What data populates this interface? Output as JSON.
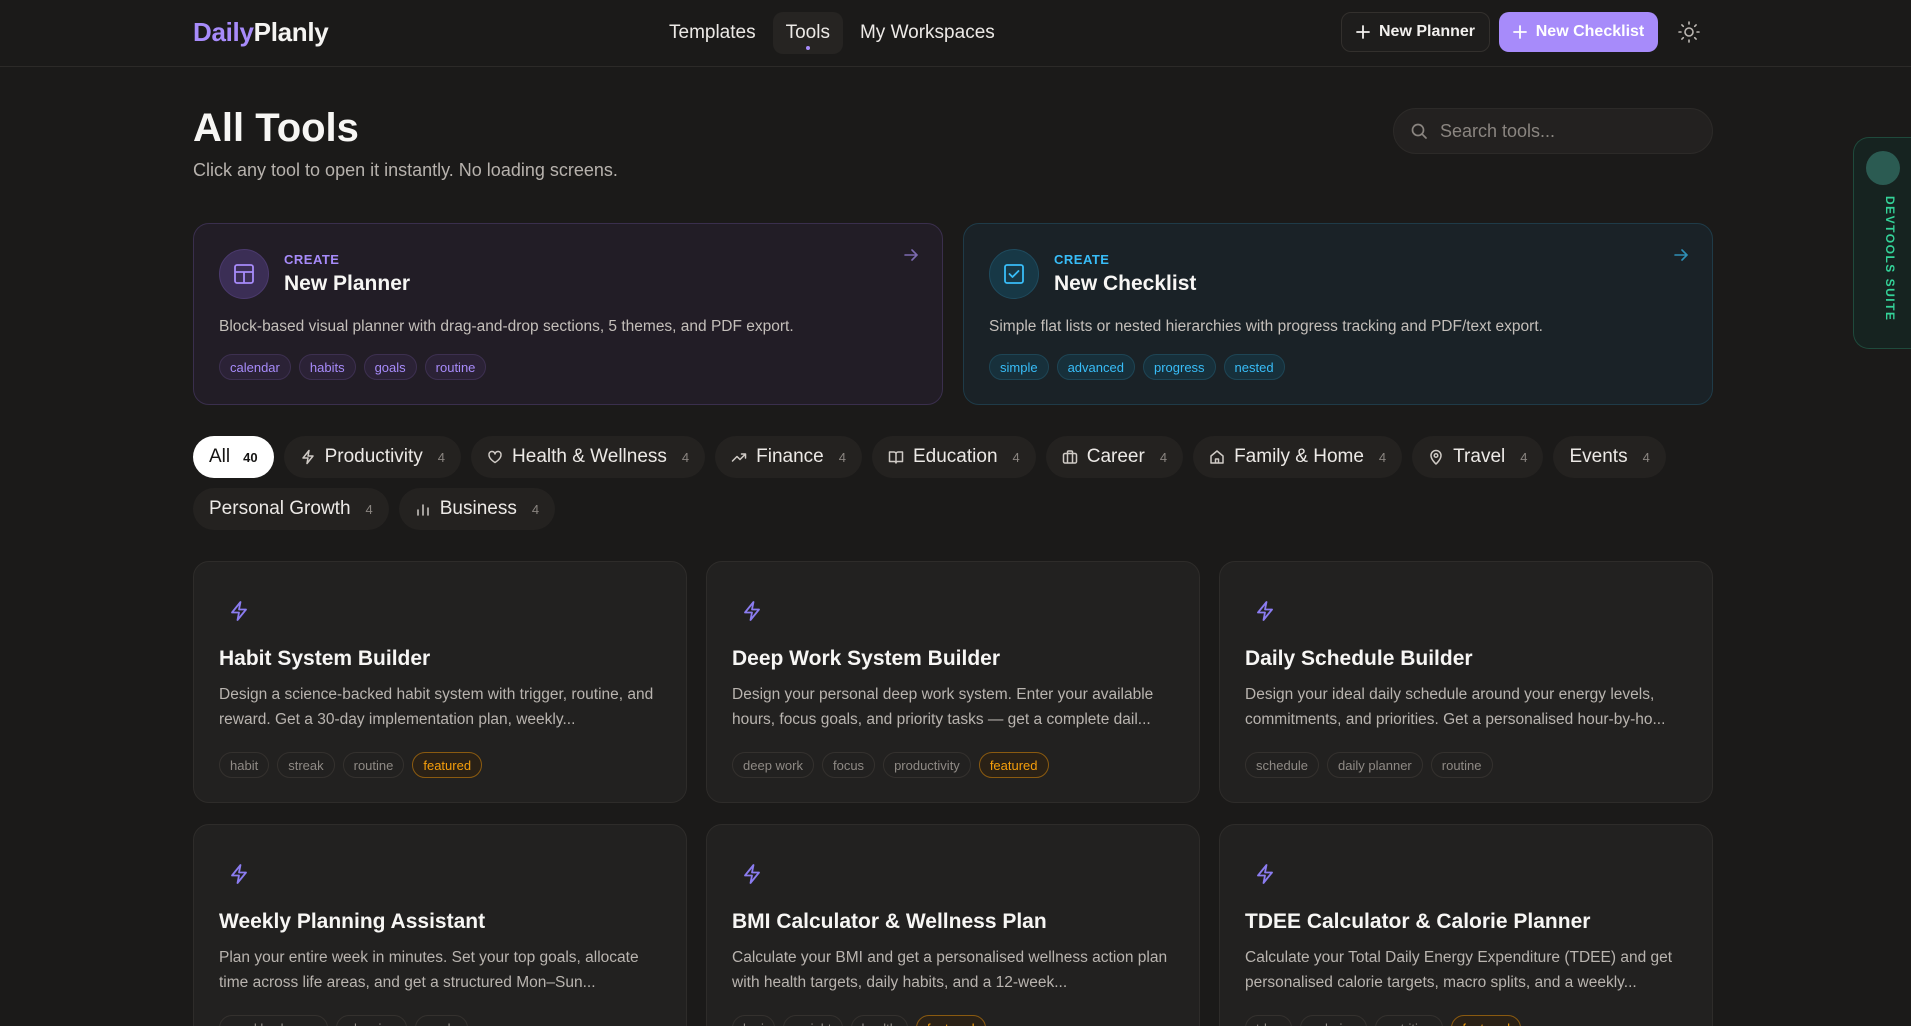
{
  "brand": {
    "part1": "Daily",
    "part2": "Planly"
  },
  "nav": {
    "items": [
      "Templates",
      "Tools",
      "My Workspaces"
    ],
    "active": "Tools"
  },
  "header": {
    "new_planner": "New Planner",
    "new_checklist": "New Checklist"
  },
  "page": {
    "title": "All Tools",
    "subtitle": "Click any tool to open it instantly. No loading screens.",
    "search_placeholder": "Search tools..."
  },
  "create_cards": [
    {
      "kicker": "CREATE",
      "title": "New Planner",
      "desc": "Block-based visual planner with drag-and-drop sections, 5 themes, and PDF export.",
      "tags": [
        "calendar",
        "habits",
        "goals",
        "routine"
      ]
    },
    {
      "kicker": "CREATE",
      "title": "New Checklist",
      "desc": "Simple flat lists or nested hierarchies with progress tracking and PDF/text export.",
      "tags": [
        "simple",
        "advanced",
        "progress",
        "nested"
      ]
    }
  ],
  "filters": [
    {
      "label": "All",
      "count": "40",
      "icon": ""
    },
    {
      "label": "Productivity",
      "count": "4",
      "icon": "bolt-icon"
    },
    {
      "label": "Health & Wellness",
      "count": "4",
      "icon": "heart-icon"
    },
    {
      "label": "Finance",
      "count": "4",
      "icon": "trending-up-icon"
    },
    {
      "label": "Education",
      "count": "4",
      "icon": "book-icon"
    },
    {
      "label": "Career",
      "count": "4",
      "icon": "briefcase-icon"
    },
    {
      "label": "Family & Home",
      "count": "4",
      "icon": "home-icon"
    },
    {
      "label": "Travel",
      "count": "4",
      "icon": "map-pin-icon"
    },
    {
      "label": "Events",
      "count": "4",
      "icon": ""
    },
    {
      "label": "Personal Growth",
      "count": "4",
      "icon": ""
    },
    {
      "label": "Business",
      "count": "4",
      "icon": "bar-chart-icon"
    }
  ],
  "tools": [
    {
      "title": "Habit System Builder",
      "desc": "Design a science-backed habit system with trigger, routine, and reward. Get a 30-day implementation plan, weekly...",
      "tags": [
        "habit",
        "streak",
        "routine",
        "featured"
      ]
    },
    {
      "title": "Deep Work System Builder",
      "desc": "Design your personal deep work system. Enter your available hours, focus goals, and priority tasks — get a complete dail...",
      "tags": [
        "deep work",
        "focus",
        "productivity",
        "featured"
      ]
    },
    {
      "title": "Daily Schedule Builder",
      "desc": "Design your ideal daily schedule around your energy levels, commitments, and priorities. Get a personalised hour-by-ho...",
      "tags": [
        "schedule",
        "daily planner",
        "routine"
      ]
    },
    {
      "title": "Weekly Planning Assistant",
      "desc": "Plan your entire week in minutes. Set your top goals, allocate time across life areas, and get a structured Mon–Sun...",
      "tags": [
        "weekly planner",
        "planning",
        "goals"
      ]
    },
    {
      "title": "BMI Calculator & Wellness Plan",
      "desc": "Calculate your BMI and get a personalised wellness action plan with health targets, daily habits, and a 12-week...",
      "tags": [
        "bmi",
        "weight",
        "health",
        "featured"
      ]
    },
    {
      "title": "TDEE Calculator & Calorie Planner",
      "desc": "Calculate your Total Daily Energy Expenditure (TDEE) and get personalised calorie targets, macro splits, and a weekly...",
      "tags": [
        "tdee",
        "calories",
        "nutrition",
        "featured"
      ]
    }
  ],
  "devtools": {
    "label": "DEVTOOLS SUITE"
  },
  "colors": {
    "accent": "#a78bfa",
    "cyan": "#38bdf8",
    "featured": "#f59e0b",
    "bg": "#1b1a19"
  }
}
